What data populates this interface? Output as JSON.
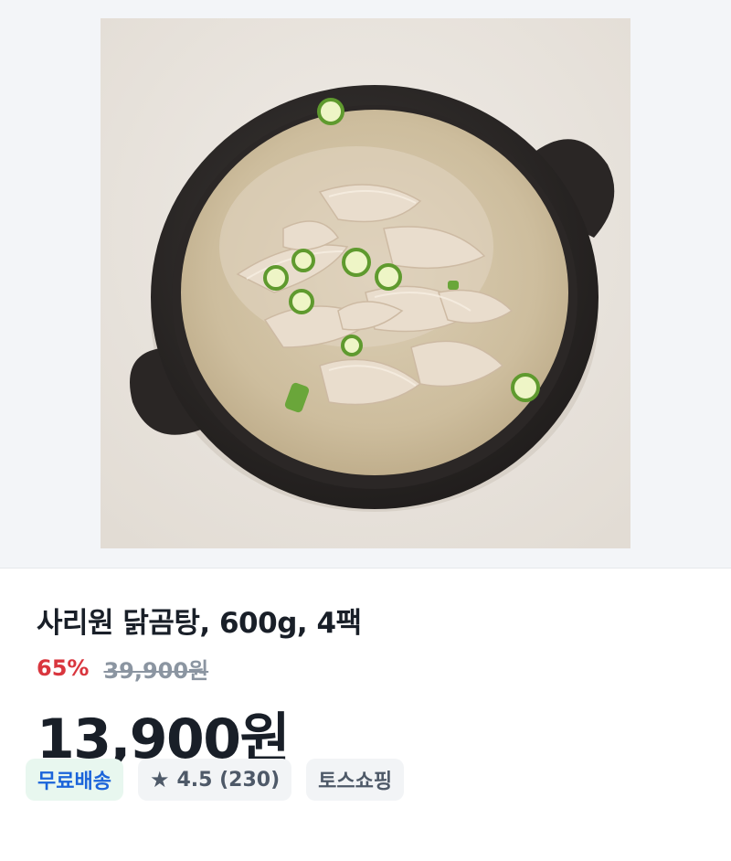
{
  "product": {
    "image_alt": "닭곰탕 뚝배기 사진",
    "title": "사리원 닭곰탕, 600g, 4팩",
    "discount": "65%",
    "original_price": "39,900원",
    "price": "13,900원"
  },
  "badges": {
    "free_shipping": "무료배송",
    "rating_icon": "star-icon",
    "rating": "4.5 (230)",
    "store": "토스쇼핑"
  },
  "colors": {
    "discount": "#d9363e",
    "free_shipping_text": "#1b64da",
    "free_shipping_bg": "#e8f7ef",
    "badge_bg": "#f2f4f6"
  }
}
